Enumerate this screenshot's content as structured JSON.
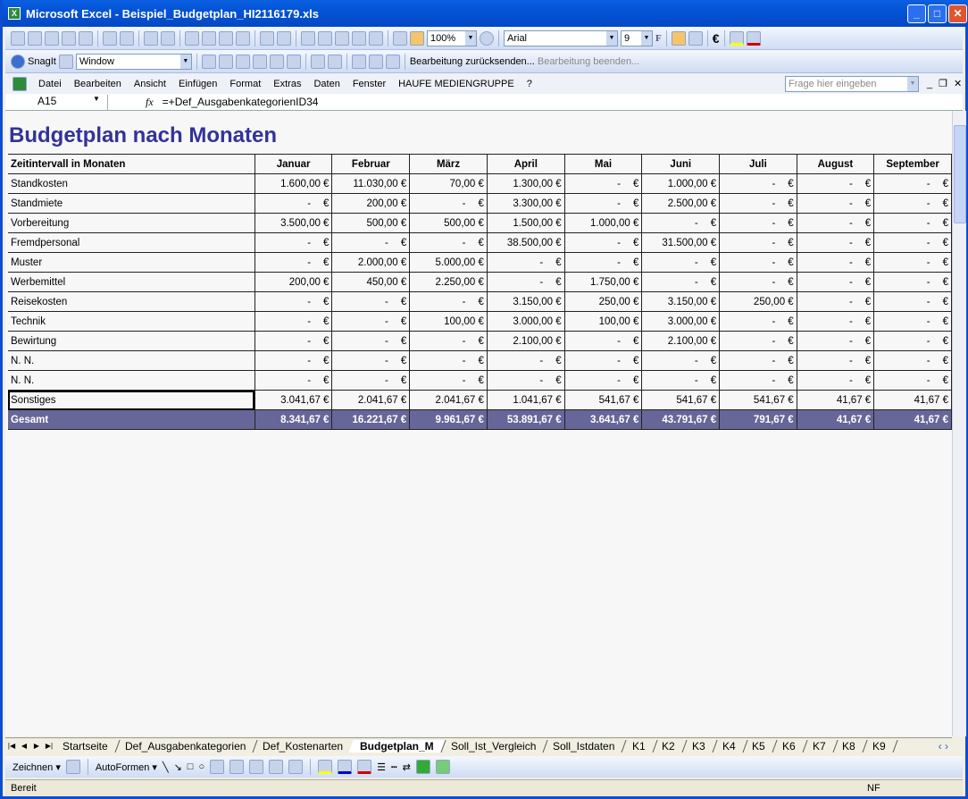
{
  "window": {
    "title": "Microsoft Excel - Beispiel_Budgetplan_HI2116179.xls"
  },
  "toolbar": {
    "zoom": "100%",
    "font": "Arial",
    "font_size": "9",
    "bold_label": "F",
    "euro": "€"
  },
  "toolbar2": {
    "snagit": "SnagIt",
    "window_combo": "Window",
    "send_back": "Bearbeitung zurücksenden...",
    "end_edit": "Bearbeitung beenden..."
  },
  "menu": {
    "items": [
      "Datei",
      "Bearbeiten",
      "Ansicht",
      "Einfügen",
      "Format",
      "Extras",
      "Daten",
      "Fenster",
      "HAUFE MEDIENGRUPPE",
      "?"
    ],
    "help_placeholder": "Frage hier eingeben"
  },
  "formula": {
    "cell": "A15",
    "fx": "fx",
    "value": "=+Def_AusgabenkategorienID34"
  },
  "sheet": {
    "title": "Budgetplan nach Monaten",
    "header": [
      "Zeitintervall in Monaten",
      "Januar",
      "Februar",
      "März",
      "April",
      "Mai",
      "Juni",
      "Juli",
      "August",
      "September"
    ],
    "currency": "€",
    "rows": [
      {
        "label": "Standkosten",
        "values": [
          "1.600,00 €",
          "11.030,00 €",
          "70,00 €",
          "1.300,00 €",
          "-",
          "1.000,00 €",
          "-",
          "-",
          "-"
        ]
      },
      {
        "label": "Standmiete",
        "values": [
          "-",
          "200,00 €",
          "-",
          "3.300,00 €",
          "-",
          "2.500,00 €",
          "-",
          "-",
          "-"
        ]
      },
      {
        "label": "Vorbereitung",
        "values": [
          "3.500,00 €",
          "500,00 €",
          "500,00 €",
          "1.500,00 €",
          "1.000,00 €",
          "-",
          "-",
          "-",
          "-"
        ]
      },
      {
        "label": "Fremdpersonal",
        "values": [
          "-",
          "-",
          "-",
          "38.500,00 €",
          "-",
          "31.500,00 €",
          "-",
          "-",
          "-"
        ]
      },
      {
        "label": "Muster",
        "values": [
          "-",
          "2.000,00 €",
          "5.000,00 €",
          "-",
          "-",
          "-",
          "-",
          "-",
          "-"
        ]
      },
      {
        "label": "Werbemittel",
        "values": [
          "200,00 €",
          "450,00 €",
          "2.250,00 €",
          "-",
          "1.750,00 €",
          "-",
          "-",
          "-",
          "-"
        ]
      },
      {
        "label": "Reisekosten",
        "values": [
          "-",
          "-",
          "-",
          "3.150,00 €",
          "250,00 €",
          "3.150,00 €",
          "250,00 €",
          "-",
          "-"
        ]
      },
      {
        "label": "Technik",
        "values": [
          "-",
          "-",
          "100,00 €",
          "3.000,00 €",
          "100,00 €",
          "3.000,00 €",
          "-",
          "-",
          "-"
        ]
      },
      {
        "label": "Bewirtung",
        "values": [
          "-",
          "-",
          "-",
          "2.100,00 €",
          "-",
          "2.100,00 €",
          "-",
          "-",
          "-"
        ]
      },
      {
        "label": "N. N.",
        "values": [
          "-",
          "-",
          "-",
          "-",
          "-",
          "-",
          "-",
          "-",
          "-"
        ]
      },
      {
        "label": "N. N.",
        "values": [
          "-",
          "-",
          "-",
          "-",
          "-",
          "-",
          "-",
          "-",
          "-"
        ]
      },
      {
        "label": "Sonstiges",
        "values": [
          "3.041,67 €",
          "2.041,67 €",
          "2.041,67 €",
          "1.041,67 €",
          "541,67 €",
          "541,67 €",
          "541,67 €",
          "41,67 €",
          "41,67 €"
        ]
      }
    ],
    "total": {
      "label": "Gesamt",
      "values": [
        "8.341,67 €",
        "16.221,67 €",
        "9.961,67 €",
        "53.891,67 €",
        "3.641,67 €",
        "43.791,67 €",
        "791,67 €",
        "41,67 €",
        "41,67 €"
      ]
    }
  },
  "tabs": [
    "Startseite",
    "Def_Ausgabenkategorien",
    "Def_Kostenarten",
    "Budgetplan_M",
    "Soll_Ist_Vergleich",
    "Soll_Istdaten",
    "K1",
    "K2",
    "K3",
    "K4",
    "K5",
    "K6",
    "K7",
    "K8",
    "K9"
  ],
  "active_tab": "Budgetplan_M",
  "drawing": {
    "draw": "Zeichnen",
    "autoshapes": "AutoFormen"
  },
  "status": {
    "text": "Bereit",
    "nf": "NF"
  },
  "colors": {
    "title": "#333399",
    "total_bg": "#666699",
    "titlebar": "#0453d6"
  }
}
